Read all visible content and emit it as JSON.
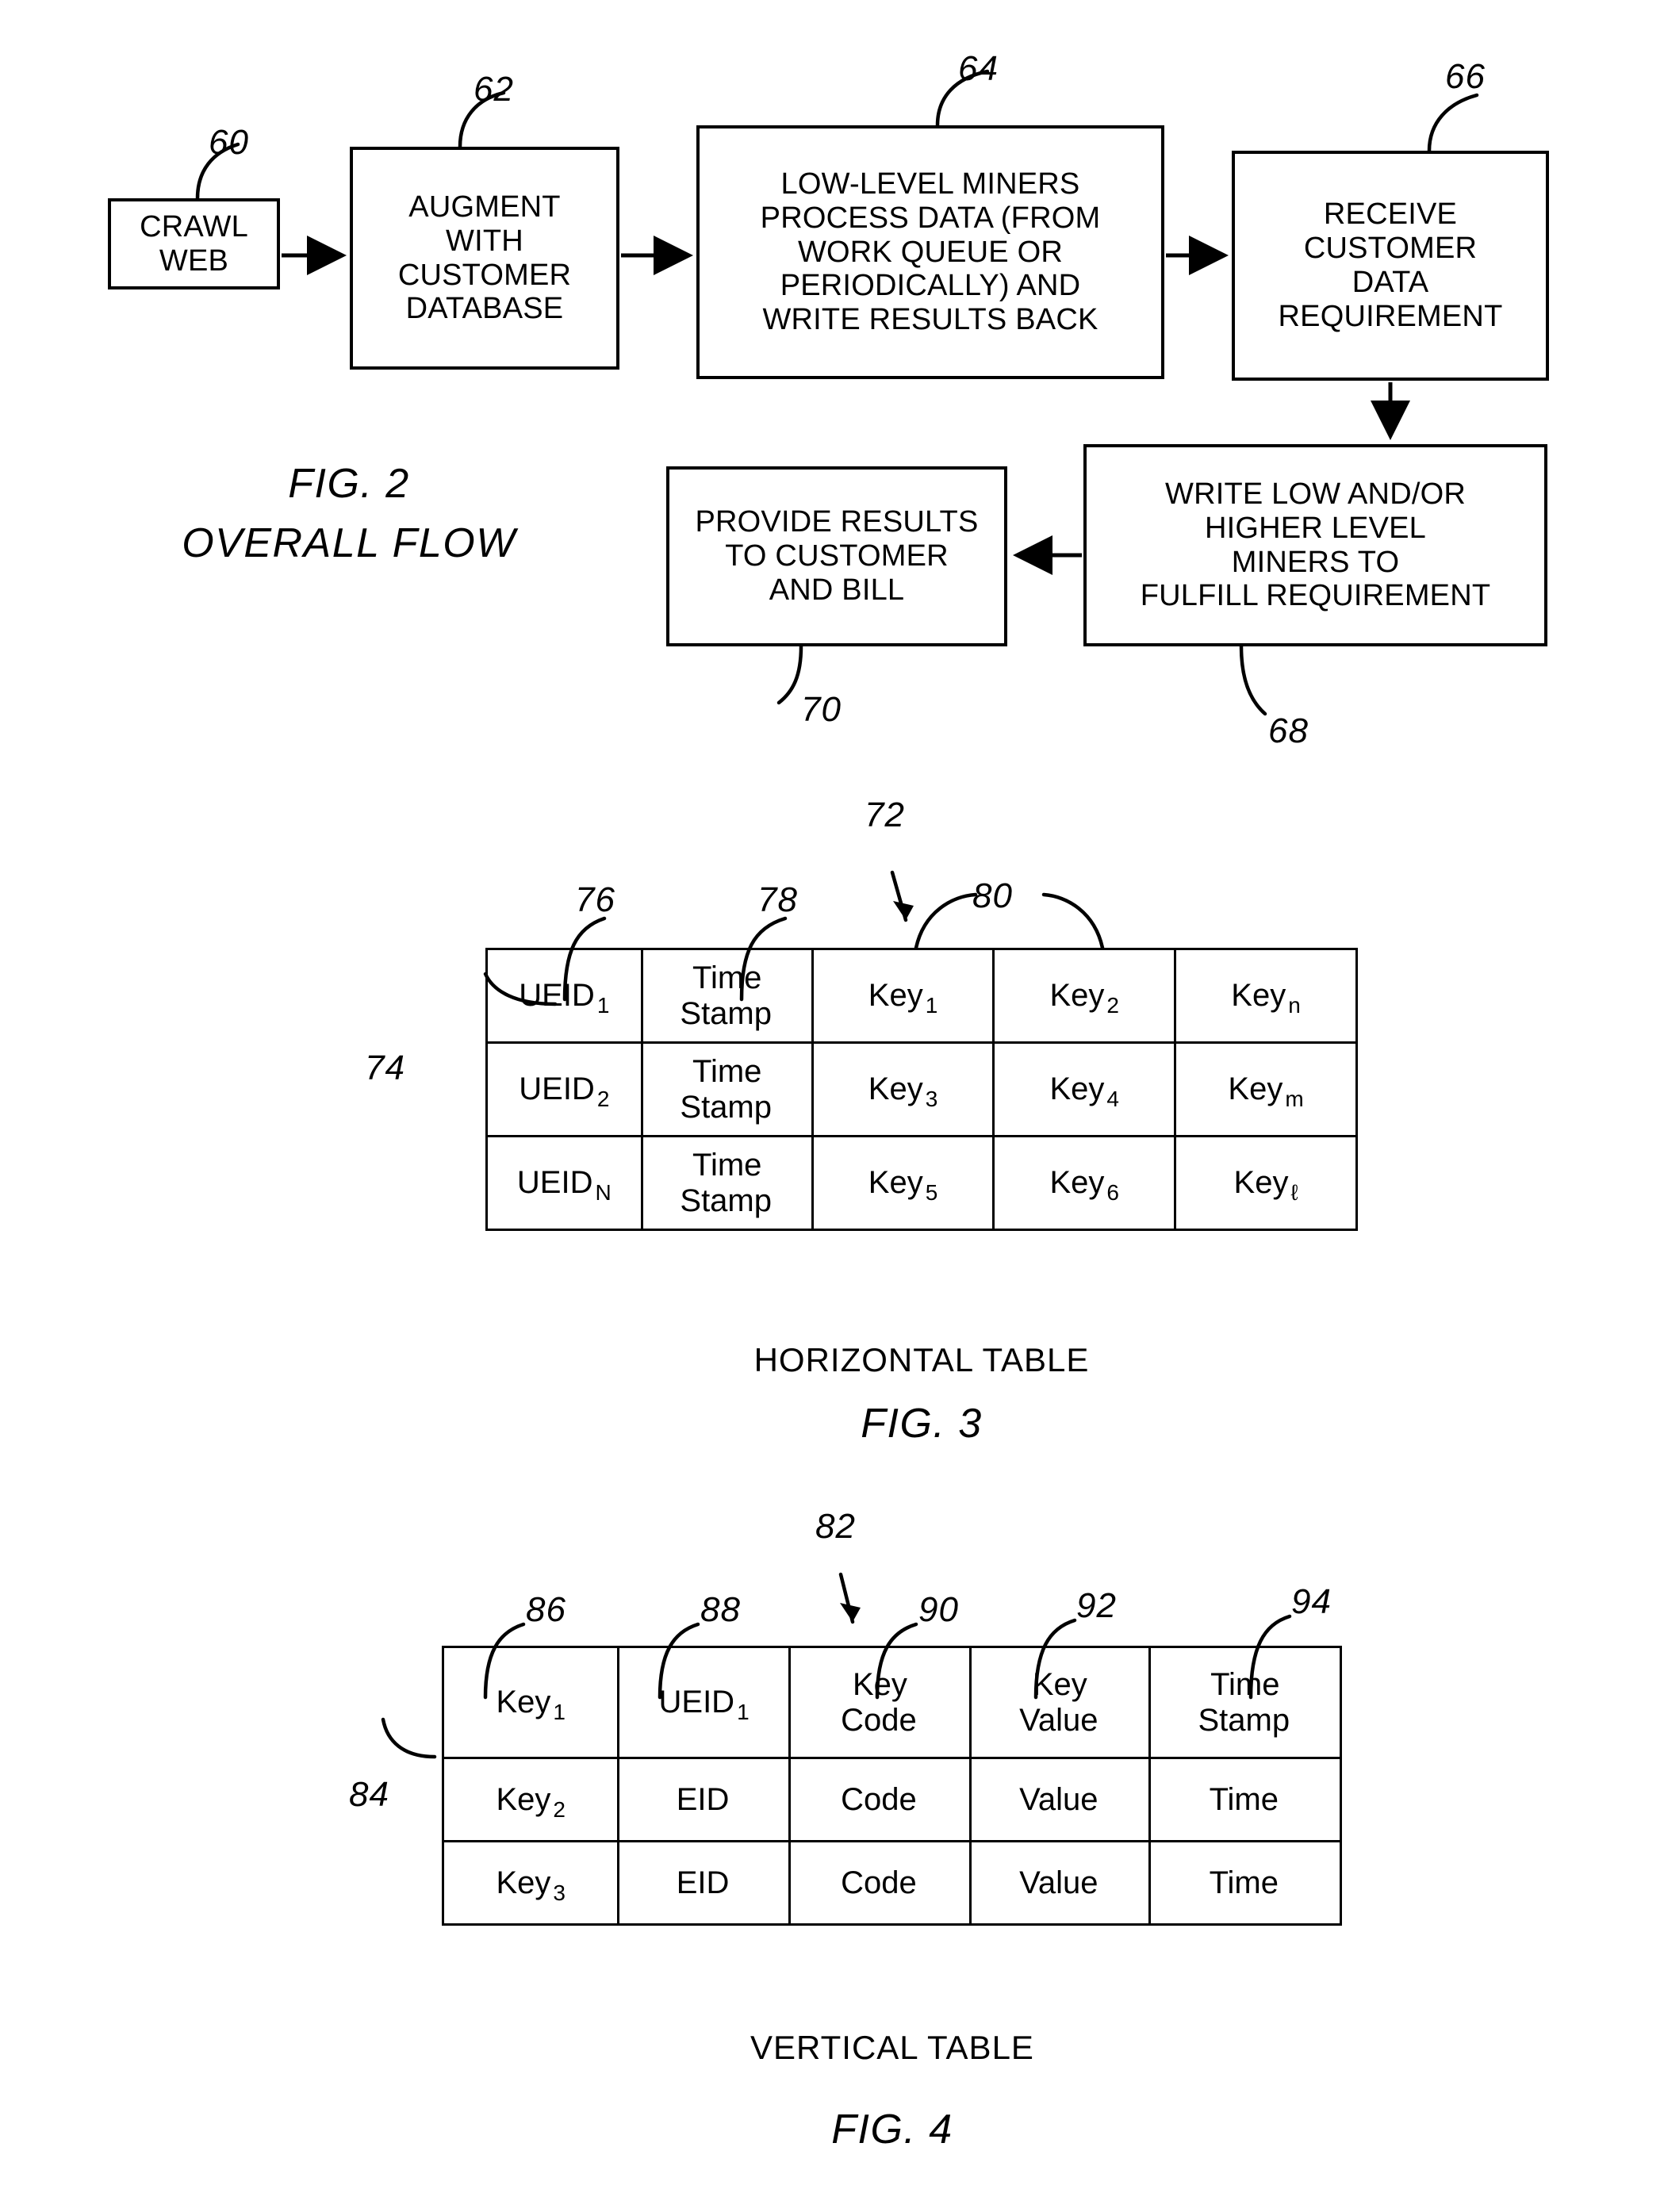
{
  "figure2": {
    "caption_line1": "FIG. 2",
    "caption_line2": "OVERALL FLOW",
    "boxes": [
      {
        "ref": "60",
        "text": "CRAWL\nWEB"
      },
      {
        "ref": "62",
        "text": "AUGMENT\nWITH\nCUSTOMER\nDATABASE"
      },
      {
        "ref": "64",
        "text": "LOW-LEVEL MINERS\nPROCESS DATA (FROM\nWORK QUEUE OR\nPERIODICALLY) AND\nWRITE RESULTS BACK"
      },
      {
        "ref": "66",
        "text": "RECEIVE\nCUSTOMER\nDATA\nREQUIREMENT"
      },
      {
        "ref": "68",
        "text": "WRITE LOW AND/OR\nHIGHER LEVEL\nMINERS TO\nFULFILL REQUIREMENT"
      },
      {
        "ref": "70",
        "text": "PROVIDE RESULTS\nTO CUSTOMER\nAND BILL"
      }
    ]
  },
  "figure3": {
    "table_ref": "72",
    "rows_ref": "74",
    "col_refs": [
      "76",
      "78",
      "80"
    ],
    "caption": "FIG. 3",
    "table_title": "HORIZONTAL TABLE",
    "rows": [
      [
        {
          "base": "UEID",
          "sub": "1"
        },
        {
          "base": "Time\nStamp",
          "sub": ""
        },
        {
          "base": "Key",
          "sub": "1"
        },
        {
          "base": "Key",
          "sub": "2"
        },
        {
          "base": "Key",
          "sub": "n"
        }
      ],
      [
        {
          "base": "UEID",
          "sub": "2"
        },
        {
          "base": "Time\nStamp",
          "sub": ""
        },
        {
          "base": "Key",
          "sub": "3"
        },
        {
          "base": "Key",
          "sub": "4"
        },
        {
          "base": "Key",
          "sub": "m"
        }
      ],
      [
        {
          "base": "UEID",
          "sub": "N"
        },
        {
          "base": "Time\nStamp",
          "sub": ""
        },
        {
          "base": "Key",
          "sub": "5"
        },
        {
          "base": "Key",
          "sub": "6"
        },
        {
          "base": "Key",
          "sub": "ℓ"
        }
      ]
    ]
  },
  "figure4": {
    "table_ref": "82",
    "rows_ref": "84",
    "col_refs": [
      "86",
      "88",
      "90",
      "92",
      "94"
    ],
    "caption": "FIG. 4",
    "table_title": "VERTICAL TABLE",
    "rows": [
      [
        {
          "base": "Key",
          "sub": "1"
        },
        {
          "base": "UEID",
          "sub": "1"
        },
        {
          "base": "Key\nCode",
          "sub": ""
        },
        {
          "base": "Key\nValue",
          "sub": ""
        },
        {
          "base": "Time\nStamp",
          "sub": ""
        }
      ],
      [
        {
          "base": "Key",
          "sub": "2"
        },
        {
          "base": "EID",
          "sub": ""
        },
        {
          "base": "Code",
          "sub": ""
        },
        {
          "base": "Value",
          "sub": ""
        },
        {
          "base": "Time",
          "sub": ""
        }
      ],
      [
        {
          "base": "Key",
          "sub": "3"
        },
        {
          "base": "EID",
          "sub": ""
        },
        {
          "base": "Code",
          "sub": ""
        },
        {
          "base": "Value",
          "sub": ""
        },
        {
          "base": "Time",
          "sub": ""
        }
      ]
    ]
  }
}
